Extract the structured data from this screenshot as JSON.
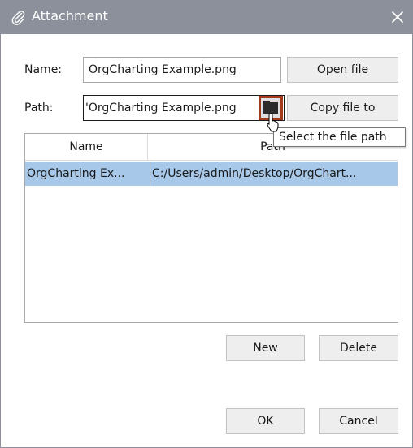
{
  "window": {
    "title": "Attachment"
  },
  "form": {
    "name_label": "Name:",
    "name_value": "OrgCharting Example.png",
    "path_label": "Path:",
    "path_value": "'OrgCharting Example.png",
    "open_file_label": "Open file",
    "copy_file_label": "Copy file to"
  },
  "tooltip": {
    "text": "Select the file path"
  },
  "table": {
    "headers": [
      "Name",
      "Path"
    ],
    "rows": [
      {
        "name": "OrgCharting Ex...",
        "path": "C:/Users/admin/Desktop/OrgChart..."
      }
    ]
  },
  "actions": {
    "new_label": "New",
    "delete_label": "Delete",
    "ok_label": "OK",
    "cancel_label": "Cancel"
  },
  "colors": {
    "titlebar": "#8c909a",
    "selection": "#a8c8ea",
    "highlight_border": "#a33a1c"
  },
  "icons": {
    "title": "paperclip-icon",
    "close": "close-icon",
    "picker": "folder-icon"
  }
}
